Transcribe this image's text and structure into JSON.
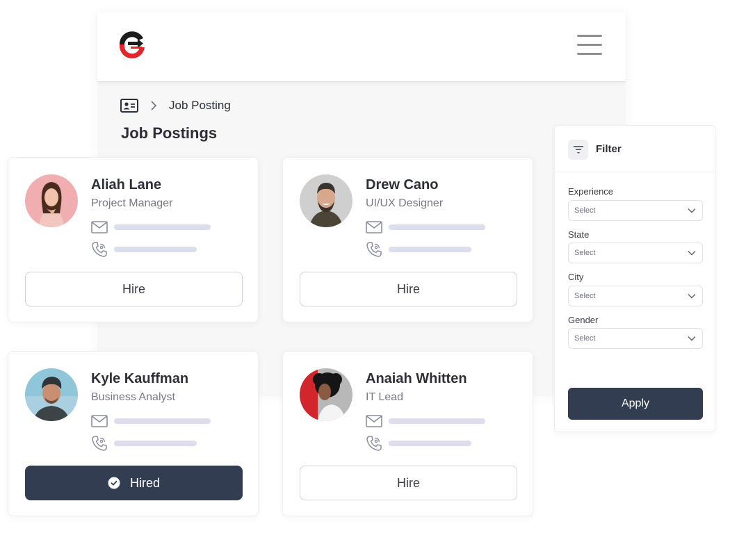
{
  "header": {
    "logo": "company-logo",
    "menu_icon": "hamburger-menu-icon"
  },
  "breadcrumb": {
    "home_icon": "id-card-icon",
    "separator_icon": "chevron-right-icon",
    "current": "Job Posting"
  },
  "page": {
    "title": "Job Postings"
  },
  "candidates": [
    {
      "name": "Aliah Lane",
      "role": "Project Manager",
      "button_label": "Hire",
      "status": "not-hired"
    },
    {
      "name": "Drew Cano",
      "role": "UI/UX Designer",
      "button_label": "Hire",
      "status": "not-hired"
    },
    {
      "name": "Kyle Kauffman",
      "role": "Business Analyst",
      "button_label": "Hired",
      "status": "hired"
    },
    {
      "name": "Anaiah Whitten",
      "role": "IT Lead",
      "button_label": "Hire",
      "status": "not-hired"
    }
  ],
  "filter": {
    "title": "Filter",
    "fields": [
      {
        "label": "Experience",
        "placeholder": "Select"
      },
      {
        "label": "State",
        "placeholder": "Select"
      },
      {
        "label": "City",
        "placeholder": "Select"
      },
      {
        "label": "Gender",
        "placeholder": "Select"
      }
    ],
    "apply_label": "Apply"
  },
  "colors": {
    "primary_dark": "#333d51",
    "logo_red": "#e3262b",
    "logo_black": "#1c1c1c",
    "placeholder_line": "#dcdfeb"
  }
}
